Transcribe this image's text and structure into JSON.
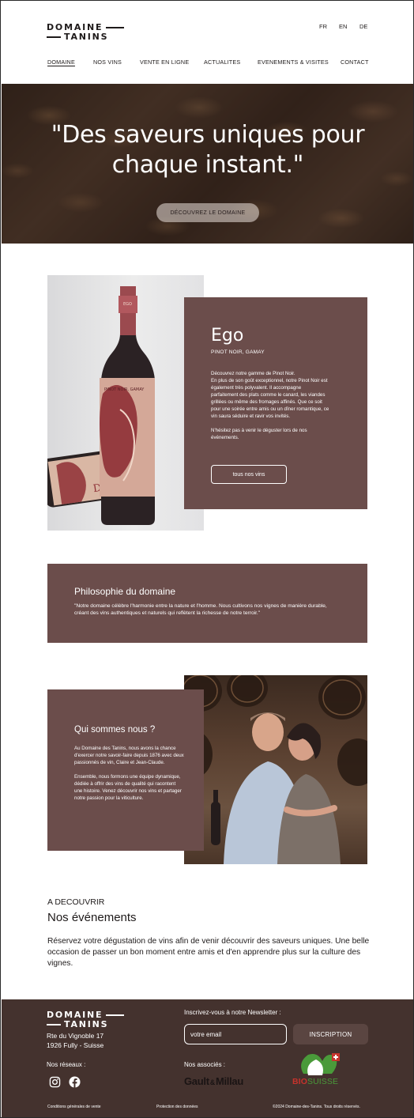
{
  "brand": {
    "line1": "DOMAINE",
    "line2": "TANINS"
  },
  "languages": [
    "FR",
    "EN",
    "DE"
  ],
  "nav": [
    "DOMAINE",
    "NOS VINS",
    "VENTE EN LIGNE",
    "ACTUALITES",
    "EVENEMENTS & VISITES",
    "CONTACT"
  ],
  "hero": {
    "quote_line1": "\"Des saveurs uniques pour",
    "quote_line2": "chaque instant.\"",
    "button": "DÉCOUVREZ LE DOMAINE"
  },
  "ego": {
    "bottle_label": "PINOT NOIR, GAMAY",
    "bottle_label_neck": "EGO",
    "bottle_label_side": "Des",
    "title": "Ego",
    "subtitle": "PINOT NOIR, GAMAY",
    "text": "Découvrez notre gamme de Pinot Noir.\nEn plus de son goût exceptionnel, notre Pinot Noir est également très polyvalent. Il accompagne parfaitement des plats comme le canard, les viandes grillées ou même des fromages affinés. Que ce soit pour une soirée entre amis ou un dîner romantique, ce vin saura séduire et ravir vos invités.\n\nN'hésitez pas à venir le déguster lors de nos événements.",
    "button": "tous nos vins"
  },
  "philosophie": {
    "title": "Philosophie du domaine",
    "text": "\"Notre domaine célèbre l'harmonie entre la nature et l'homme. Nous cultivons nos vignes de manière durable, créant des vins authentiques et naturels qui reflètent la richesse de notre terroir.\""
  },
  "qui": {
    "title": "Qui sommes nous ?",
    "text": "Au Domaine des Tanins, nous avons la chance d'exercer notre savoir-faire depuis 1876 avec deux passionnés de vin, Claire et Jean-Claude.\n\nEnsemble, nous formons une équipe dynamique, dédiée à offrir des vins de qualité qui racontent une histoire. Venez découvrir nos vins et partager notre passion pour la viticulture."
  },
  "events": {
    "kicker": "A DECOUVRIR",
    "title": "Nos événements",
    "text": "Réservez votre dégustation de vins afin de venir découvrir des saveurs uniques. Une belle occasion de passer un bon moment entre amis et d'en apprendre plus sur la culture des vignes."
  },
  "footer": {
    "address": "Rte du Vignoble 17\n1926 Fully - Suisse",
    "reseaux": "Nos réseaux :",
    "newsletter": "Inscrivez-vous à notre Newsletter :",
    "email_placeholder": "votre email",
    "subscribe": "INSCRIPTION",
    "associes": "Nos associés :",
    "gm_left": "Gault",
    "gm_amp": "&",
    "gm_right": "Millau",
    "bio_1": "BIO",
    "bio_2": "SUISSE",
    "legal": [
      "Conditions générales de vente",
      "Protection des données",
      "©2024 Domaine-des-Tanins. Tous droits réservés."
    ]
  },
  "colors": {
    "card": "#6b4d4b",
    "footer": "#44322e",
    "accent_red": "#c6332c",
    "accent_green": "#4a9a3a"
  }
}
